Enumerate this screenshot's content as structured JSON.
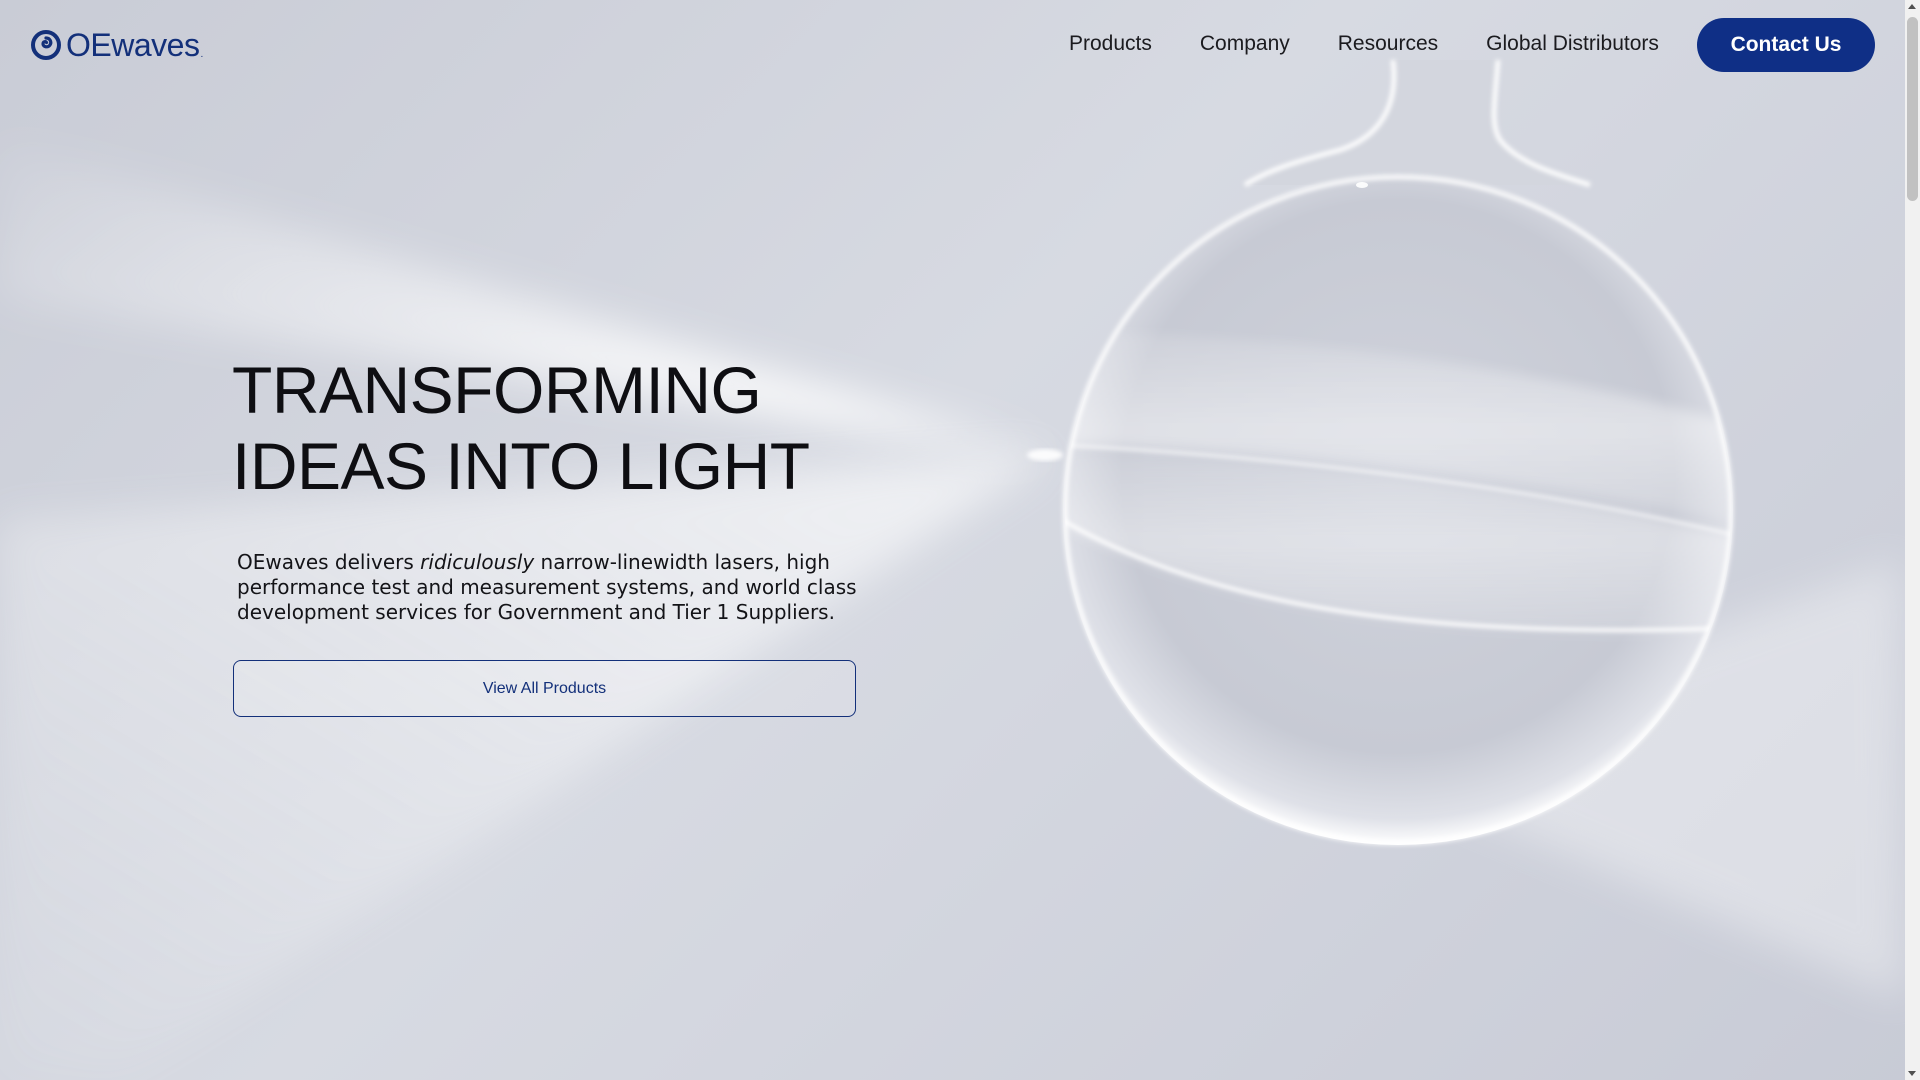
{
  "header": {
    "logo": {
      "text": "OEwaves",
      "trademark": ".",
      "icon": "oewaves-swirl-logo-icon",
      "color": "#13307a"
    },
    "nav": [
      "Products",
      "Company",
      "Resources",
      "Global Distributors"
    ],
    "contact_label": "Contact Us",
    "contact_color": "#0f2f86"
  },
  "hero": {
    "title_line1": "TRANSFORMING",
    "title_line2": "IDEAS INTO LIGHT",
    "desc_before": "OEwaves delivers ",
    "desc_emphasis": "ridiculously",
    "desc_after": " narrow-linewidth lasers, high performance test and measurement systems, and world class development services for Government and Tier 1 Suppliers.",
    "button_label": "View All Products",
    "illustration": "glass-droplet-resonator-illustration"
  },
  "scrollbar": {
    "present": true
  }
}
